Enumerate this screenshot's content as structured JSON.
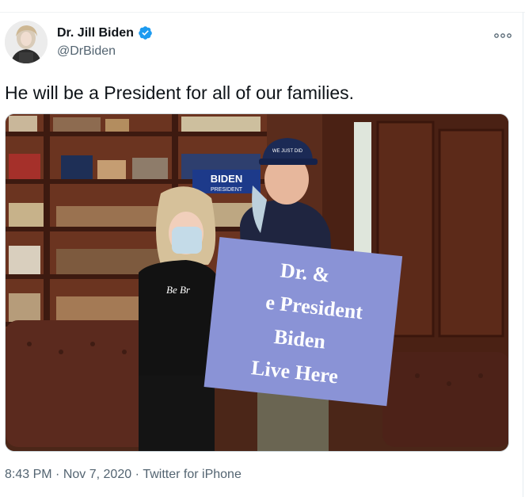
{
  "tweet": {
    "author": {
      "display_name": "Dr. Jill Biden",
      "handle": "@DrBiden",
      "verified": true,
      "avatar_icon": "profile-photo"
    },
    "more_icon": "more-horizontal-icon",
    "text": "He will be a President for all of our families.",
    "media": {
      "sign_lines": [
        "Dr. &",
        "e President",
        "Biden",
        "Live Here"
      ],
      "banner_text": "BIDEN",
      "banner_sub": "PRESIDENT",
      "shirt_text": "Be Br",
      "hat_text": "WE JUST DID"
    },
    "meta": {
      "time": "8:43 PM",
      "separator": "·",
      "date": "Nov 7, 2020",
      "source": "Twitter for iPhone"
    }
  },
  "colors": {
    "text": "#0f1419",
    "secondary_text": "#536471",
    "verified": "#1d9bf0",
    "sign": "#8a93d6"
  }
}
